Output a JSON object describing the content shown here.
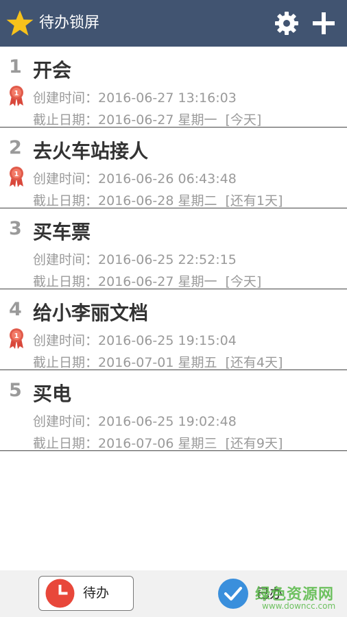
{
  "header": {
    "title": "待办锁屏",
    "icons": [
      "star-icon",
      "gear-icon",
      "plus-icon"
    ],
    "background": "#415471"
  },
  "tasks": [
    {
      "number": "1",
      "title": "开会",
      "flagged": true,
      "created_label": "创建时间：",
      "created": "2016-06-27 13:16:03",
      "deadline_label": "截止日期：",
      "deadline": "2016-06-27 星期一",
      "status": "[今天]"
    },
    {
      "number": "2",
      "title": "去火车站接人",
      "flagged": true,
      "created_label": "创建时间：",
      "created": "2016-06-26 06:43:48",
      "deadline_label": "截止日期：",
      "deadline": "2016-06-28 星期二",
      "status": "[还有1天]"
    },
    {
      "number": "3",
      "title": "买车票",
      "flagged": false,
      "created_label": "创建时间：",
      "created": "2016-06-25 22:52:15",
      "deadline_label": "截止日期：",
      "deadline": "2016-06-27 星期一",
      "status": "[今天]"
    },
    {
      "number": "4",
      "title": "给小李丽文档",
      "flagged": true,
      "created_label": "创建时间：",
      "created": "2016-06-25 19:15:04",
      "deadline_label": "截止日期：",
      "deadline": "2016-07-01 星期五",
      "status": "[还有4天]"
    },
    {
      "number": "5",
      "title": "买电",
      "flagged": false,
      "created_label": "创建时间：",
      "created": "2016-06-25 19:02:48",
      "deadline_label": "截止日期：",
      "deadline": "2016-07-06 星期三",
      "status": "[还有9天]"
    }
  ],
  "bottombar": {
    "pending_label": "待办",
    "done_label": "已办",
    "pending_icon": "clock-icon",
    "done_icon": "check-icon",
    "accent_red": "#e8473a",
    "accent_blue": "#3a8fdc"
  },
  "watermark": {
    "title": "绿色资源网",
    "url": "www.downcc.com"
  }
}
